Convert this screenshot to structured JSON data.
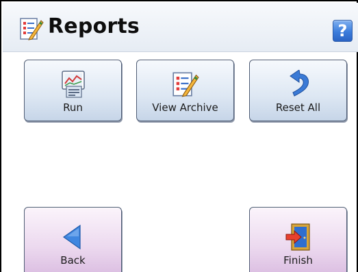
{
  "header": {
    "title": "Reports",
    "title_icon": "report-edit-icon",
    "help_label": "?"
  },
  "buttons": {
    "run": {
      "label": "Run",
      "icon": "chart-report-icon"
    },
    "view_archive": {
      "label": "View Archive",
      "icon": "report-edit-icon"
    },
    "reset_all": {
      "label": "Reset All",
      "icon": "undo-arrow-icon"
    },
    "back": {
      "label": "Back",
      "icon": "back-triangle-icon"
    },
    "finish": {
      "label": "Finish",
      "icon": "exit-door-icon"
    }
  },
  "colors": {
    "header_bg": "#e6ecf4",
    "button_blue": "#dde7f3",
    "button_pink": "#ecd9ef",
    "help_blue": "#3c7ddc",
    "icon_blue": "#3a7ad6"
  }
}
